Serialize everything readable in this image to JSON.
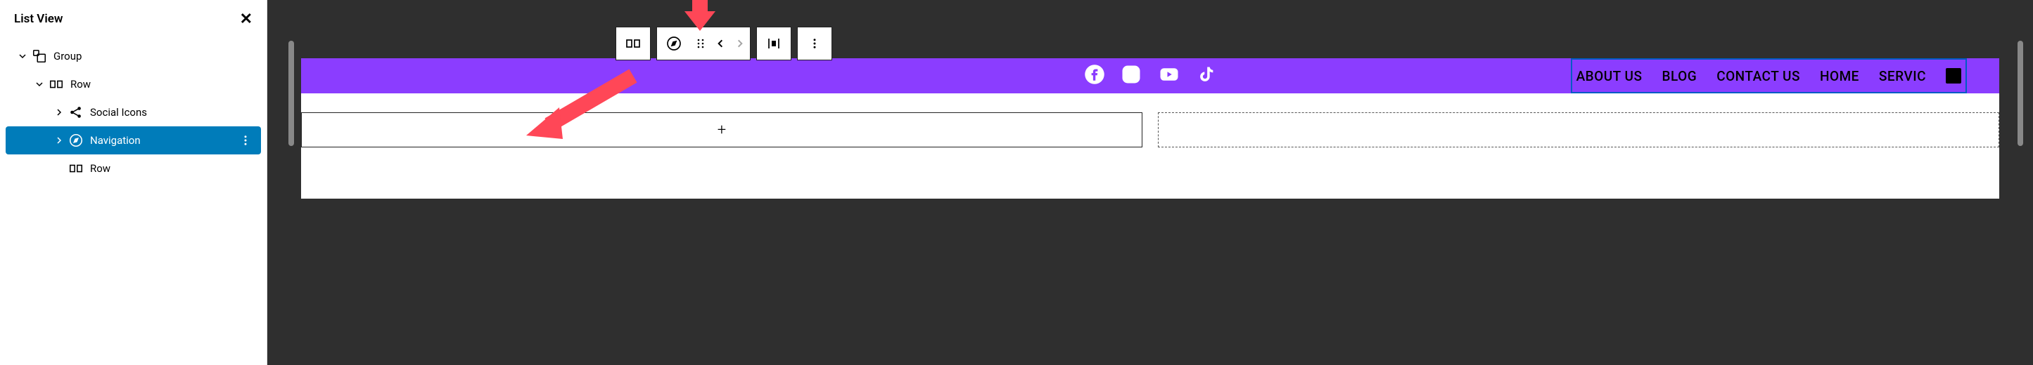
{
  "sidebar": {
    "title": "List View",
    "items": [
      {
        "label": "Group",
        "indent": 0,
        "expanded": true,
        "icon": "group",
        "selected": false
      },
      {
        "label": "Row",
        "indent": 1,
        "expanded": true,
        "icon": "row",
        "selected": false
      },
      {
        "label": "Social Icons",
        "indent": 2,
        "expanded": false,
        "expandIcon": "right",
        "icon": "share",
        "selected": false
      },
      {
        "label": "Navigation",
        "indent": 2,
        "expanded": false,
        "expandIcon": "right",
        "icon": "compass",
        "selected": true
      },
      {
        "label": "Row",
        "indent": 2,
        "expanded": false,
        "expandIcon": "none",
        "icon": "row",
        "selected": false
      }
    ]
  },
  "canvas": {
    "nav_items": [
      "ABOUT US",
      "BLOG",
      "CONTACT US",
      "HOME",
      "SERVIC"
    ],
    "add_label": "+",
    "placeholder_plus": "+"
  },
  "toolbar": {
    "buttons": [
      {
        "name": "row-icon",
        "group": 0
      },
      {
        "name": "compass-icon",
        "group": 1
      },
      {
        "name": "drag-handle-icon",
        "group": 1
      },
      {
        "name": "move-left-icon",
        "group": 1
      },
      {
        "name": "move-right-icon",
        "group": 1,
        "disabled": true
      },
      {
        "name": "justify-icon",
        "group": 2
      },
      {
        "name": "more-icon",
        "group": 3
      }
    ]
  },
  "colors": {
    "accent": "#8b3dff",
    "selection": "#007cba",
    "arrow": "#ff4757"
  }
}
